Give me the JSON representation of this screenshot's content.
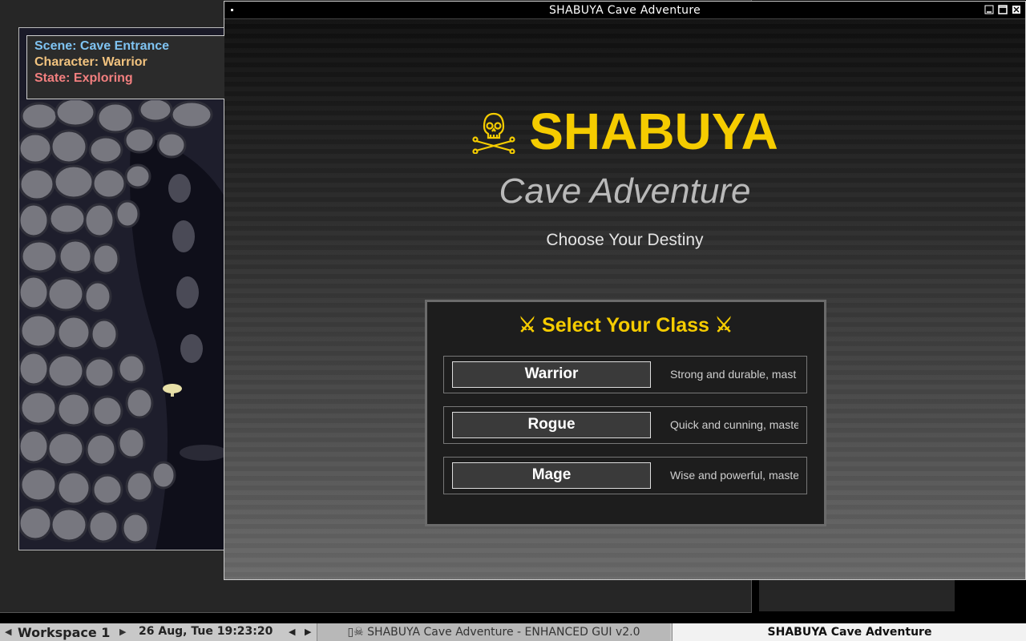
{
  "background_window": {
    "status": {
      "scene": "Scene: Cave Entrance",
      "character": "Character: Warrior",
      "state": "State: Exploring"
    },
    "colors": {
      "scene": "#7fc3f2",
      "character": "#f2c37f",
      "state": "#f27f7f"
    }
  },
  "window": {
    "title": "SHABUYA Cave Adventure",
    "icons": [
      "minimize-icon",
      "maximize-icon",
      "close-icon"
    ]
  },
  "main": {
    "logo_icon": "skull-crossbones-icon",
    "title": "SHABUYA",
    "subtitle": "Cave Adventure",
    "tagline": "Choose Your Destiny",
    "class_heading": "⚔ Select Your Class ⚔",
    "classes": [
      {
        "name": "Warrior",
        "description": "Strong and durable, mast"
      },
      {
        "name": "Rogue",
        "description": "Quick and cunning, maste"
      },
      {
        "name": "Mage",
        "description": "Wise and powerful, maste"
      }
    ],
    "accent_color": "#f5cc00"
  },
  "taskbar": {
    "workspace": "Workspace 1",
    "clock": "26 Aug, Tue 19:23:20",
    "tasks": [
      {
        "label": "▯☠ SHABUYA Cave Adventure - ENHANCED GUI v2.0"
      },
      {
        "label": "SHABUYA Cave Adventure"
      }
    ]
  }
}
